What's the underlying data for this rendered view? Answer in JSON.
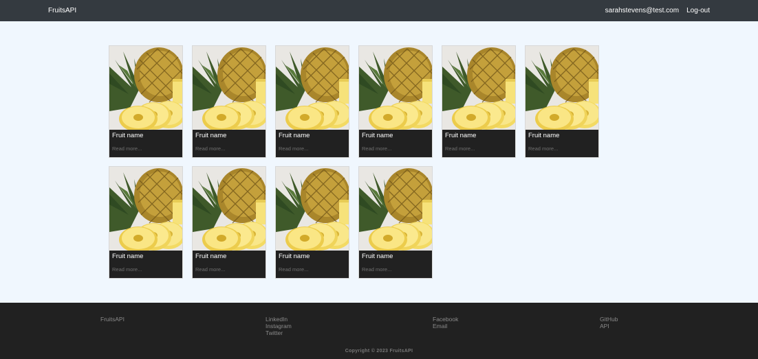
{
  "navbar": {
    "brand": "FruitsAPI",
    "user_email": "sarahstevens@test.com",
    "logout_label": "Log-out"
  },
  "cards": [
    {
      "title": "Fruit name",
      "link": "Read more..."
    },
    {
      "title": "Fruit name",
      "link": "Read more..."
    },
    {
      "title": "Fruit name",
      "link": "Read more..."
    },
    {
      "title": "Fruit name",
      "link": "Read more..."
    },
    {
      "title": "Fruit name",
      "link": "Read more..."
    },
    {
      "title": "Fruit name",
      "link": "Read more..."
    },
    {
      "title": "Fruit name",
      "link": "Read more..."
    },
    {
      "title": "Fruit name",
      "link": "Read more..."
    },
    {
      "title": "Fruit name",
      "link": "Read more..."
    },
    {
      "title": "Fruit name",
      "link": "Read more..."
    }
  ],
  "card_image": "pineapple-image",
  "footer": {
    "columns": [
      [
        "FruitsAPI"
      ],
      [
        "LinkedIn",
        "Instagram",
        "Twitter"
      ],
      [
        "Facebook",
        "Email"
      ],
      [
        "GitHub",
        "API"
      ]
    ],
    "copyright": "Copyright © 2023 FruitsAPI"
  },
  "colors": {
    "navbar_bg": "#343a40",
    "page_bg": "#f0f7fe",
    "card_body_bg": "#212121",
    "footer_bg": "#212121"
  }
}
